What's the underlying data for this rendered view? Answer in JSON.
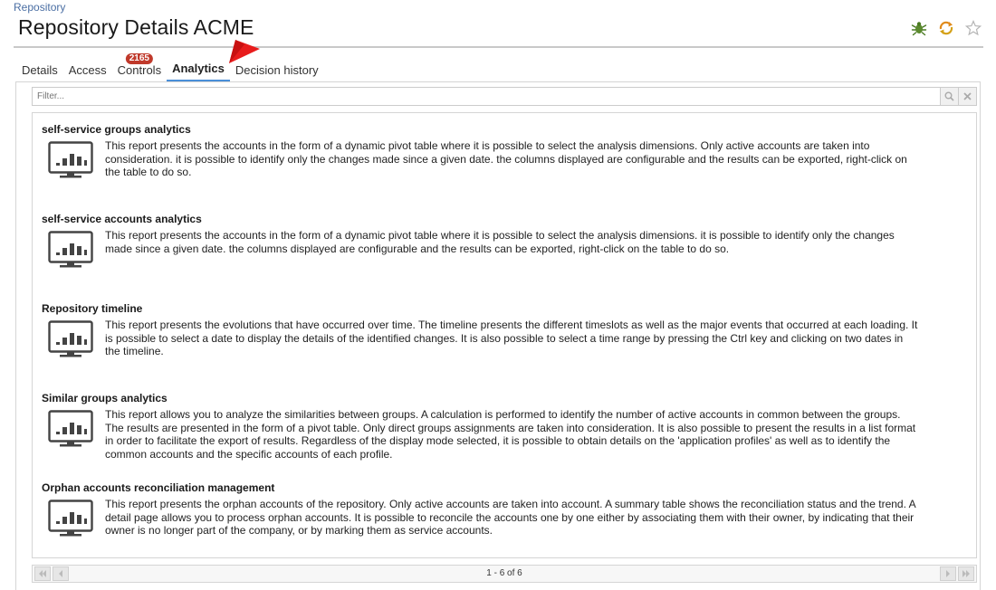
{
  "breadcrumb": "Repository",
  "page_title": "Repository Details ACME",
  "header_icons": [
    "bug-icon",
    "sync-icon",
    "star-icon"
  ],
  "tabs": [
    {
      "label": "Details",
      "active": false
    },
    {
      "label": "Access",
      "active": false
    },
    {
      "label": "Controls",
      "active": false,
      "badge": "2165"
    },
    {
      "label": "Analytics",
      "active": true
    },
    {
      "label": "Decision history",
      "active": false
    }
  ],
  "filter": {
    "placeholder": "Filter..."
  },
  "reports": [
    {
      "title": "self-service groups analytics",
      "description": "This report presents the accounts in the form of a dynamic pivot table where it is possible to select the analysis dimensions. Only active accounts are taken into consideration. it is possible to identify only the changes made since a given date. the columns displayed are configurable and the results can be exported, right-click on the table to do so."
    },
    {
      "title": "self-service accounts analytics",
      "description": "This report presents the accounts in the form of a dynamic pivot table where it is possible to select the analysis dimensions. it is possible to identify only the changes made since a given date. the columns displayed are configurable and the results can be exported, right-click on the table to do so."
    },
    {
      "title": "Repository timeline",
      "description": "This report presents the evolutions that have occurred over time. The timeline presents the different timeslots as well as the major events that occurred at each loading. It is possible to select a date to display the details of the identified changes. It is also possible to select a time range by pressing the Ctrl key and clicking on two dates in the timeline."
    },
    {
      "title": "Similar groups analytics",
      "description": "This report allows you to analyze the similarities between groups. A calculation is performed to identify the number of active accounts in common between the groups. The results are presented in the form of a pivot table. Only direct groups assignments are taken into consideration. It is also possible to present the results in a list format in order to facilitate the export of results. Regardless of the display mode selected, it is possible to obtain details on the 'application profiles' as well as to identify the common accounts and the specific accounts of each profile."
    },
    {
      "title": "Orphan accounts reconciliation management",
      "description": "This report presents the orphan accounts of the repository. Only active accounts are taken into account. A summary table shows the reconciliation status and the trend. A detail page allows you to process orphan accounts. It is possible to reconcile the accounts one by one either by associating them with their owner, by indicating that their owner is no longer part of the company, or by marking them as service accounts."
    }
  ],
  "pager": {
    "text": "1 - 6 of 6"
  },
  "colors": {
    "accent": "#4a8fd8",
    "badge": "#c0392b",
    "arrow": "#e81c1c",
    "breadcrumb": "#4a6ea3"
  }
}
